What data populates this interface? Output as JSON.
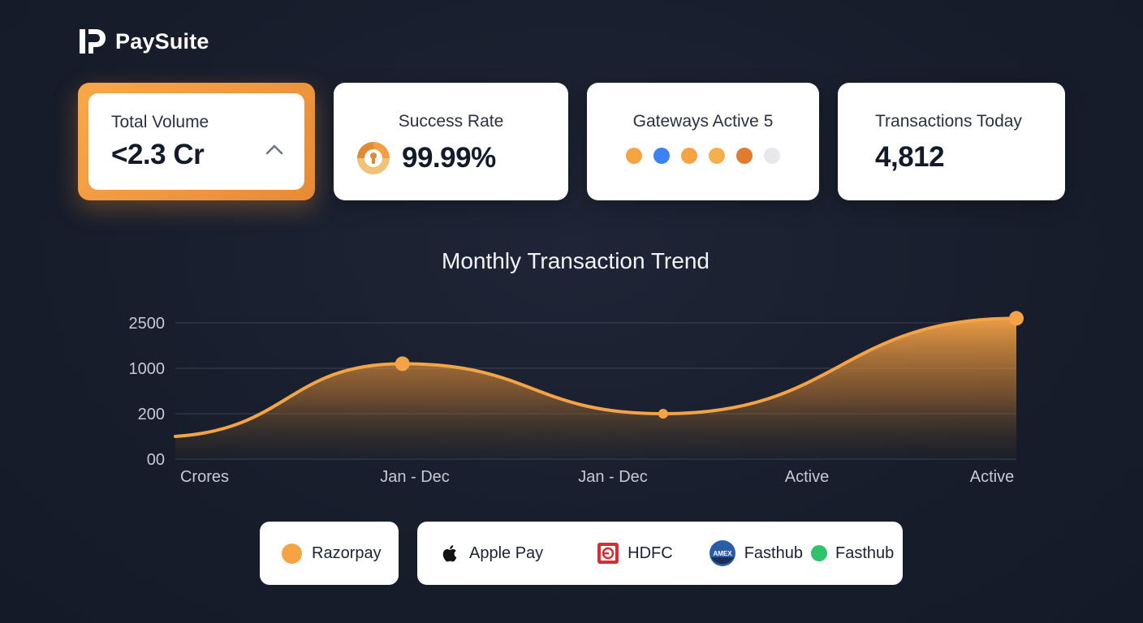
{
  "brand": {
    "name": "PaySuite",
    "logo_icon": "paysuite-logo-icon"
  },
  "cards": {
    "total_volume": {
      "title": "Total Volume",
      "value": "<2.3 Cr",
      "icon": "chevron-up-icon",
      "accent": "#f29b40"
    },
    "success_rate": {
      "title": "Success Rate",
      "value": "99.99%",
      "icon": "keyhole-badge-icon"
    },
    "gateways": {
      "title": "Gateways Active 5",
      "dot_colors": [
        "#f6a443",
        "#3b82f6",
        "#f6a443",
        "#f5b04e",
        "#e07b2f",
        "#e8e8ea"
      ]
    },
    "transactions": {
      "title": "Transactions Today",
      "value": "4,812"
    }
  },
  "chart_data": {
    "type": "area",
    "title": "Monthly Transaction Trend",
    "y_ticks": [
      "2500",
      "1000",
      "200",
      "00"
    ],
    "x_labels": [
      "Crores",
      "Jan - Dec",
      "Jan - Dec",
      "Active",
      "Active"
    ],
    "series": [
      {
        "color": "#f5a347",
        "points": [
          {
            "x": 0,
            "y": 100
          },
          {
            "x": 0.27,
            "y": 1150
          },
          {
            "x": 0.58,
            "y": 200
          },
          {
            "x": 1.0,
            "y": 2650
          }
        ]
      }
    ],
    "highlighted_points": [
      {
        "x": 0.27,
        "y": 1150
      },
      {
        "x": 0.58,
        "y": 200
      },
      {
        "x": 1.0,
        "y": 2650
      }
    ],
    "grid": true,
    "line_color": "#f5a347"
  },
  "legend": {
    "razorpay": {
      "label": "Razorpay",
      "color": "#f6a443"
    },
    "items": [
      {
        "label": "Apple Pay",
        "icon": "apple-icon"
      },
      {
        "label": "HDFC",
        "icon": "hdfc-icon",
        "color": "#d62e35"
      },
      {
        "label": "Fasthub",
        "icon": "amex-icon",
        "icon_text": "AMEX",
        "color": "#2b5ca8"
      },
      {
        "label": "Fasthub",
        "icon": "green-dot-icon",
        "color": "#2ec26a"
      }
    ]
  }
}
